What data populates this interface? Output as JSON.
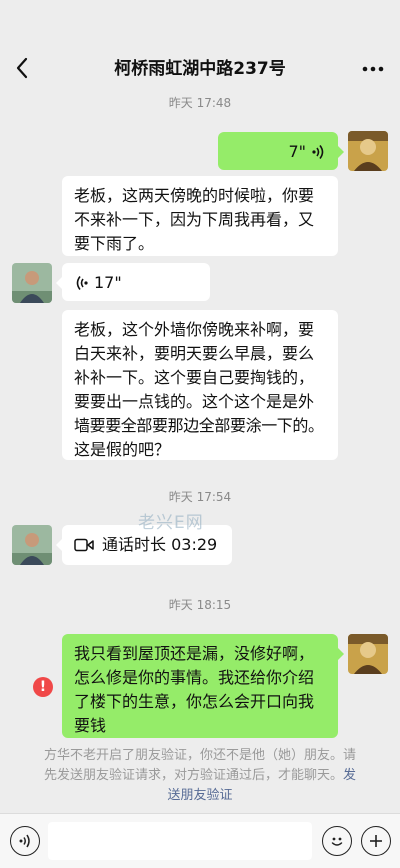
{
  "header": {
    "title": "柯桥雨虹湖中路237号",
    "back_icon": "chevron-left-icon",
    "more_icon": "more-horizontal-icon"
  },
  "messages": [
    {
      "type": "timestamp",
      "text": "昨天 17:48"
    },
    {
      "type": "voice",
      "side": "right",
      "duration": "7\""
    },
    {
      "type": "text",
      "side": "left",
      "lines": [
        "老板，这两天傍晚的时候啦，你要",
        "不来补一下，因为下周我再看，又",
        "要下雨了。"
      ]
    },
    {
      "type": "voice",
      "side": "left",
      "duration": "17\""
    },
    {
      "type": "text",
      "side": "left",
      "lines": [
        "老板，这个外墙你傍晚来补啊，要",
        "白天来补，要明天要么早晨，要么",
        "补补一下。这个要自己要掏钱的，",
        "要要出一点钱的。这个这个是是外",
        "墙要要全部要那边全部要涂一下的。",
        "这是假的吧？"
      ]
    },
    {
      "type": "timestamp",
      "text": "昨天 17:54"
    },
    {
      "type": "call",
      "side": "left",
      "text": "通话时长 03:29"
    },
    {
      "type": "timestamp",
      "text": "昨天 18:15"
    },
    {
      "type": "text",
      "side": "right",
      "failed": true,
      "lines": [
        "我只看到屋顶还是漏，没修好啊，",
        "怎么修是你的事情。我还给你介绍",
        "了楼下的生意，你怎么会开口向我",
        "要钱"
      ]
    }
  ],
  "system_notice": {
    "lines": [
      "方华不老开启了朋友验证，你还不是他（她）朋友。请",
      "先发送朋友验证请求，对方验证通过后，才能聊天。"
    ],
    "link_tail": "发",
    "link_line": "送朋友验证"
  },
  "watermark": "老兴E网",
  "bottom_bar": {
    "voice_icon": "voice-input-icon",
    "emoji_icon": "emoji-icon",
    "plus_icon": "plus-icon"
  },
  "colors": {
    "background": "#ededed",
    "bubble_green": "#95ec69",
    "bubble_white": "#ffffff",
    "error_red": "#f04848",
    "link_blue": "#576b95"
  }
}
